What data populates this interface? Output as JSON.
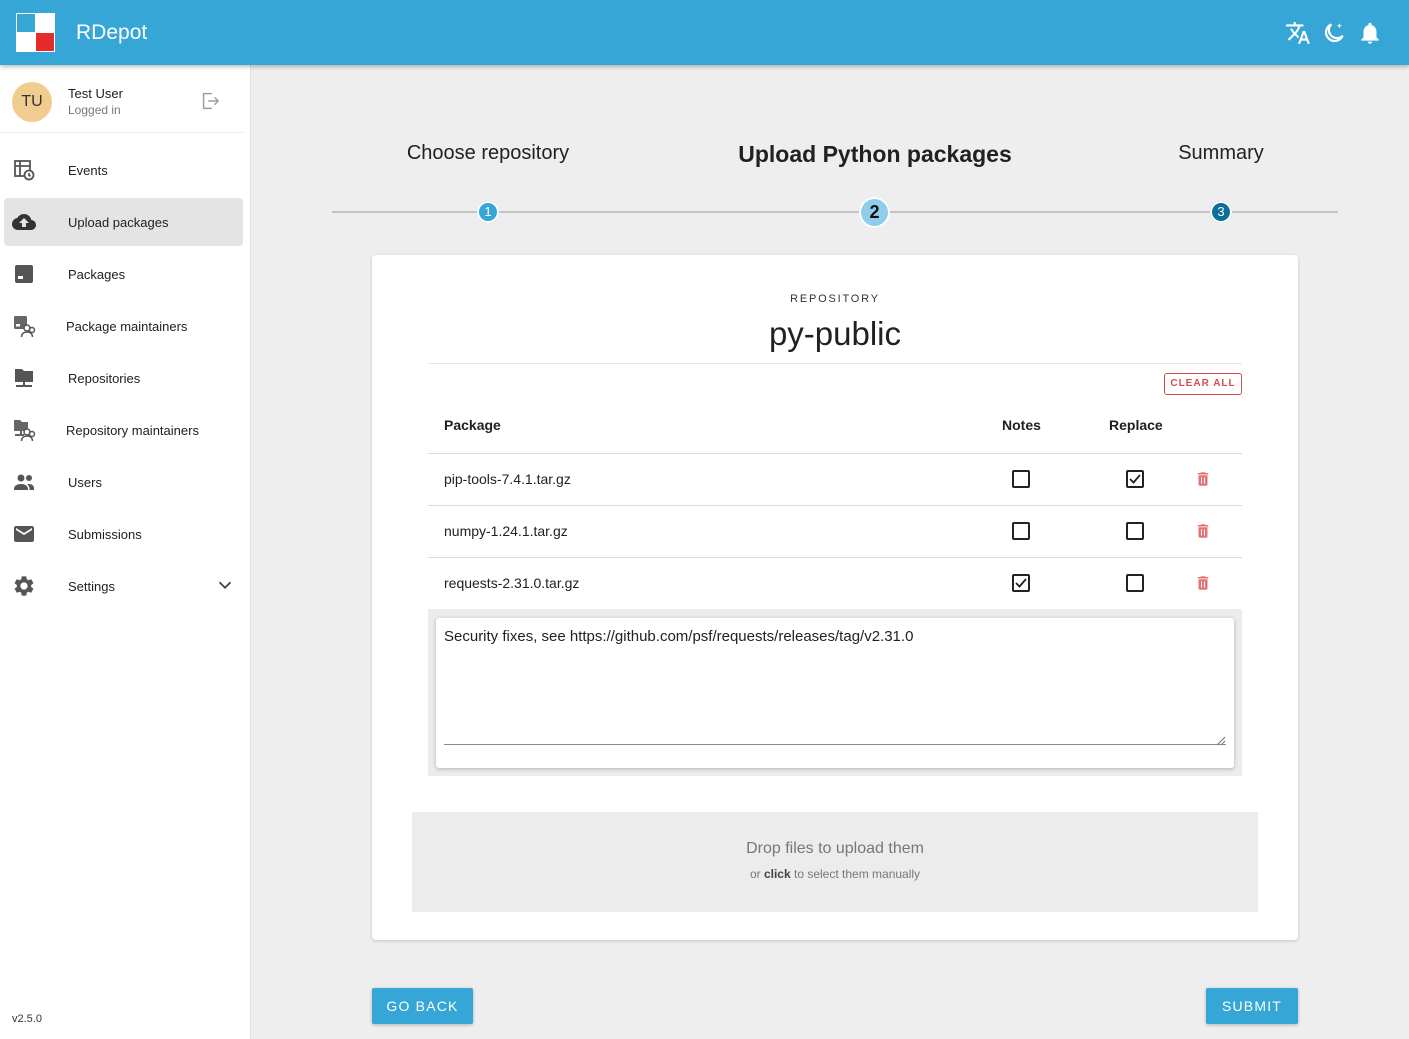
{
  "header": {
    "app_title": "RDepot",
    "icons": [
      "translate-icon",
      "dark-mode-icon",
      "bell-icon"
    ],
    "color": "#35a6d5"
  },
  "sidebar": {
    "user": {
      "initials": "TU",
      "name": "Test User",
      "status": "Logged in"
    },
    "items": [
      {
        "label": "Events",
        "icon": "events-icon"
      },
      {
        "label": "Upload packages",
        "icon": "cloud-upload-icon",
        "active": true
      },
      {
        "label": "Packages",
        "icon": "package-icon"
      },
      {
        "label": "Package maintainers",
        "icon": "package-maintainers-icon"
      },
      {
        "label": "Repositories",
        "icon": "folder-network-icon"
      },
      {
        "label": "Repository maintainers",
        "icon": "repository-maintainers-icon"
      },
      {
        "label": "Users",
        "icon": "users-icon"
      },
      {
        "label": "Submissions",
        "icon": "mail-icon"
      },
      {
        "label": "Settings",
        "icon": "gear-icon"
      }
    ],
    "version": "v2.5.0"
  },
  "stepper": {
    "steps": [
      {
        "title": "Choose repository",
        "number": "1",
        "state": "complete"
      },
      {
        "title": "Upload Python packages",
        "number": "2",
        "state": "current"
      },
      {
        "title": "Summary",
        "number": "3",
        "state": "upcoming"
      }
    ]
  },
  "card": {
    "repo_caption": "REPOSITORY",
    "repo_name": "py-public",
    "clear_all": "CLEAR ALL",
    "columns": {
      "package": "Package",
      "notes": "Notes",
      "replace": "Replace"
    },
    "rows": [
      {
        "file": "pip-tools-7.4.1.tar.gz",
        "notes": false,
        "replace": true
      },
      {
        "file": "numpy-1.24.1.tar.gz",
        "notes": false,
        "replace": false
      },
      {
        "file": "requests-2.31.0.tar.gz",
        "notes": true,
        "replace": false
      }
    ],
    "notes_text": "Security fixes, see https://github.com/psf/requests/releases/tag/v2.31.0",
    "dropzone": {
      "main": "Drop files to upload them",
      "sub_prefix": "or ",
      "sub_bold": "click",
      "sub_suffix": " to select them manually"
    }
  },
  "buttons": {
    "back": "GO BACK",
    "submit": "SUBMIT"
  },
  "colors": {
    "primary": "#35a6d5",
    "danger": "#e57373",
    "step_complete": "#35a6d5",
    "step_current": "#8fcdeb",
    "step_upcoming": "#0d6e96"
  }
}
